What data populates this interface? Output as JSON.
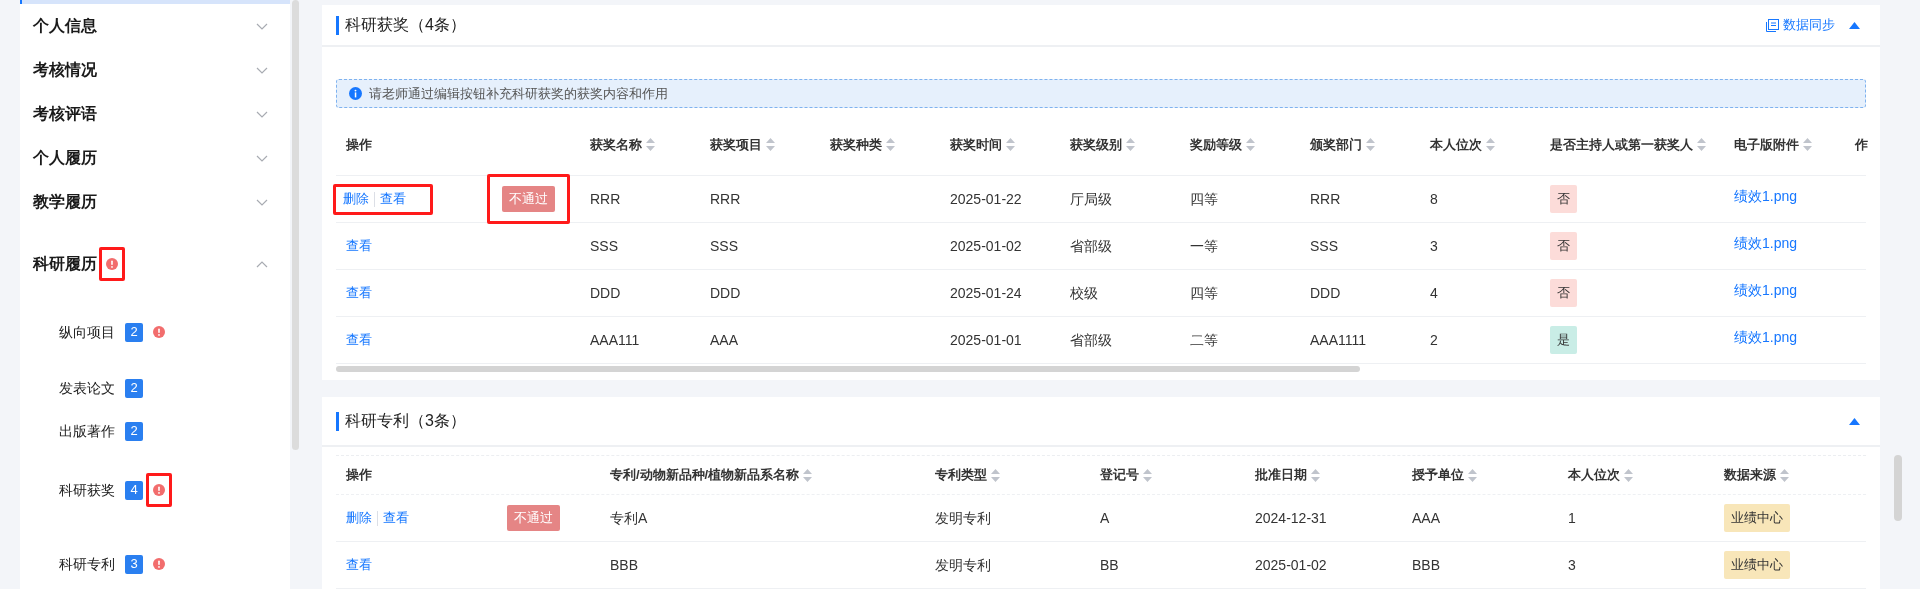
{
  "sidebar": {
    "sections": [
      {
        "label": "个人信息",
        "expanded": false
      },
      {
        "label": "考核情况",
        "expanded": false
      },
      {
        "label": "考核评语",
        "expanded": false
      },
      {
        "label": "个人履历",
        "expanded": false
      },
      {
        "label": "教学履历",
        "expanded": false
      },
      {
        "label": "科研履历",
        "expanded": true,
        "alert": {
          "highlighted": true
        },
        "children": [
          {
            "label": "纵向项目",
            "count": "2",
            "alert": {
              "highlighted": false
            }
          },
          {
            "label": "发表论文",
            "count": "2"
          },
          {
            "label": "出版著作",
            "count": "2"
          },
          {
            "label": "科研获奖",
            "count": "4",
            "alert": {
              "highlighted": true
            }
          },
          {
            "label": "科研专利",
            "count": "3",
            "alert": {
              "highlighted": false
            }
          }
        ]
      }
    ]
  },
  "cards": [
    {
      "title": "科研获奖（4条）",
      "sync_label": "数据同步",
      "expanded": true,
      "notice": "请老师通过编辑按钮补充科研获奖的获奖内容和作用",
      "columns": [
        {
          "label": "操作",
          "sortable": false
        },
        {},
        {
          "label": "获奖名称",
          "sortable": true
        },
        {
          "label": "获奖项目",
          "sortable": true
        },
        {
          "label": "获奖种类",
          "sortable": true
        },
        {
          "label": "获奖时间",
          "sortable": true
        },
        {
          "label": "获奖级别",
          "sortable": true
        },
        {
          "label": "奖励等级",
          "sortable": true
        },
        {
          "label": "颁奖部门",
          "sortable": true
        },
        {
          "label": "本人位次",
          "sortable": true
        },
        {
          "label": "是否主持人或第一获奖人",
          "sortable": true
        },
        {
          "label": "电子版附件",
          "sortable": true
        },
        {
          "label": "作",
          "sortable": false
        }
      ],
      "rows": [
        {
          "cells": [
            {
              "kind": "actions",
              "actions": [
                "删除",
                "查看"
              ],
              "highlighted": true
            },
            {
              "kind": "status",
              "text": "不通过",
              "highlighted": true
            },
            {
              "kind": "text",
              "text": "RRR"
            },
            {
              "kind": "text",
              "text": "RRR"
            },
            {
              "kind": "empty"
            },
            {
              "kind": "text",
              "text": "2025-01-22"
            },
            {
              "kind": "text",
              "text": "厅局级"
            },
            {
              "kind": "text",
              "text": "四等"
            },
            {
              "kind": "text",
              "text": "RRR"
            },
            {
              "kind": "text",
              "text": "8"
            },
            {
              "kind": "tag",
              "text": "否",
              "color": "#fcdcd9"
            },
            {
              "kind": "link",
              "text": "绩效1.png"
            },
            {
              "kind": "empty"
            }
          ]
        },
        {
          "cells": [
            {
              "kind": "actions",
              "actions": [
                "查看"
              ],
              "highlighted": false
            },
            {
              "kind": "empty"
            },
            {
              "kind": "text",
              "text": "SSS"
            },
            {
              "kind": "text",
              "text": "SSS"
            },
            {
              "kind": "empty"
            },
            {
              "kind": "text",
              "text": "2025-01-02"
            },
            {
              "kind": "text",
              "text": "省部级"
            },
            {
              "kind": "text",
              "text": "一等"
            },
            {
              "kind": "text",
              "text": "SSS"
            },
            {
              "kind": "text",
              "text": "3"
            },
            {
              "kind": "tag",
              "text": "否",
              "color": "#fcdcd9"
            },
            {
              "kind": "link",
              "text": "绩效1.png"
            },
            {
              "kind": "empty"
            }
          ]
        },
        {
          "cells": [
            {
              "kind": "actions",
              "actions": [
                "查看"
              ],
              "highlighted": false
            },
            {
              "kind": "empty"
            },
            {
              "kind": "text",
              "text": "DDD"
            },
            {
              "kind": "text",
              "text": "DDD"
            },
            {
              "kind": "empty"
            },
            {
              "kind": "text",
              "text": "2025-01-24"
            },
            {
              "kind": "text",
              "text": "校级"
            },
            {
              "kind": "text",
              "text": "四等"
            },
            {
              "kind": "text",
              "text": "DDD"
            },
            {
              "kind": "text",
              "text": "4"
            },
            {
              "kind": "tag",
              "text": "否",
              "color": "#fcdcd9"
            },
            {
              "kind": "link",
              "text": "绩效1.png"
            },
            {
              "kind": "empty"
            }
          ]
        },
        {
          "cells": [
            {
              "kind": "actions",
              "actions": [
                "查看"
              ],
              "highlighted": false
            },
            {
              "kind": "empty"
            },
            {
              "kind": "text",
              "text": "AAA111"
            },
            {
              "kind": "text",
              "text": "AAA"
            },
            {
              "kind": "empty"
            },
            {
              "kind": "text",
              "text": "2025-01-01"
            },
            {
              "kind": "text",
              "text": "省部级"
            },
            {
              "kind": "text",
              "text": "二等"
            },
            {
              "kind": "text",
              "text": "AAA1111"
            },
            {
              "kind": "text",
              "text": "2"
            },
            {
              "kind": "tag",
              "text": "是",
              "color": "#c9ede6"
            },
            {
              "kind": "link",
              "text": "绩效1.png"
            },
            {
              "kind": "empty"
            }
          ]
        }
      ]
    },
    {
      "title": "科研专利（3条）",
      "expanded": true,
      "columns": [
        {
          "label": "操作",
          "sortable": false
        },
        {},
        {
          "label": "专利/动物新品种/植物新品系名称",
          "sortable": true
        },
        {
          "label": "专利类型",
          "sortable": true
        },
        {
          "label": "登记号",
          "sortable": true
        },
        {
          "label": "批准日期",
          "sortable": true
        },
        {
          "label": "授予单位",
          "sortable": true
        },
        {
          "label": "本人位次",
          "sortable": true
        },
        {
          "label": "数据来源",
          "sortable": true
        }
      ],
      "rows": [
        {
          "cells": [
            {
              "kind": "actions",
              "actions": [
                "删除",
                "查看"
              ],
              "highlighted": false
            },
            {
              "kind": "status",
              "text": "不通过",
              "highlighted": false
            },
            {
              "kind": "text",
              "text": "专利A"
            },
            {
              "kind": "text",
              "text": "发明专利"
            },
            {
              "kind": "text",
              "text": "A"
            },
            {
              "kind": "text",
              "text": "2024-12-31"
            },
            {
              "kind": "text",
              "text": "AAA"
            },
            {
              "kind": "text",
              "text": "1"
            },
            {
              "kind": "tag",
              "text": "业绩中心",
              "color": "#f8e6b9"
            }
          ]
        },
        {
          "cells": [
            {
              "kind": "actions",
              "actions": [
                "查看"
              ],
              "highlighted": false
            },
            {
              "kind": "empty"
            },
            {
              "kind": "text",
              "text": "BBB"
            },
            {
              "kind": "text",
              "text": "发明专利"
            },
            {
              "kind": "text",
              "text": "BB"
            },
            {
              "kind": "text",
              "text": "2025-01-02"
            },
            {
              "kind": "text",
              "text": "BBB"
            },
            {
              "kind": "text",
              "text": "3"
            },
            {
              "kind": "tag",
              "text": "业绩中心",
              "color": "#f8e6b9"
            }
          ]
        }
      ]
    }
  ]
}
